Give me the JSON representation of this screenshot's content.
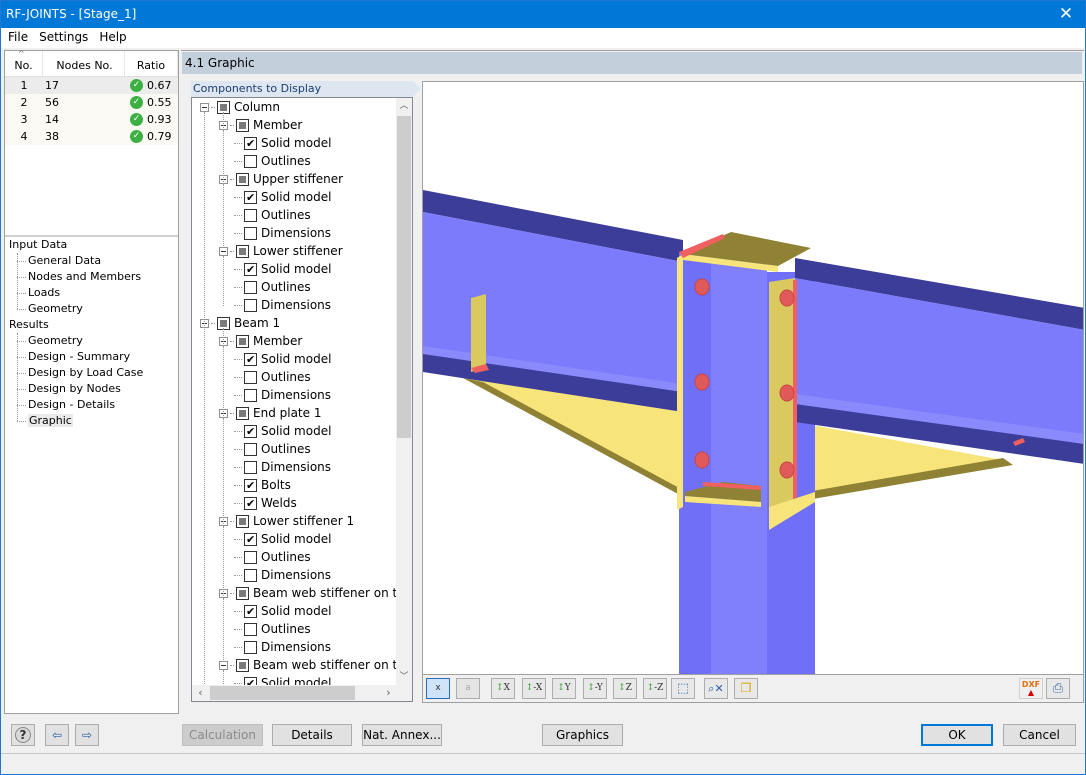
{
  "window": {
    "title": "RF-JOINTS - [Stage_1]",
    "close_icon": "close-icon"
  },
  "menu": [
    "File",
    "Settings",
    "Help"
  ],
  "nodes_table": {
    "columns": [
      "No.",
      "Nodes No.",
      "Ratio"
    ],
    "rows": [
      {
        "no": "1",
        "node": "17",
        "ratio": "0.67",
        "status": "ok"
      },
      {
        "no": "2",
        "node": "56",
        "ratio": "0.55",
        "status": "ok"
      },
      {
        "no": "3",
        "node": "14",
        "ratio": "0.93",
        "status": "ok"
      },
      {
        "no": "4",
        "node": "38",
        "ratio": "0.79",
        "status": "ok"
      }
    ]
  },
  "navigator": {
    "groups": [
      {
        "label": "Input Data",
        "items": [
          "General Data",
          "Nodes and Members",
          "Loads",
          "Geometry"
        ]
      },
      {
        "label": "Results",
        "items": [
          "Geometry",
          "Design - Summary",
          "Design by Load Case",
          "Design by Nodes",
          "Design - Details",
          "Graphic"
        ]
      }
    ],
    "selected": "Graphic"
  },
  "section": {
    "title": "4.1 Graphic"
  },
  "components": {
    "header": "Components to Display",
    "tree": [
      {
        "label": "Column",
        "level": 0,
        "state": "partial"
      },
      {
        "label": "Member",
        "level": 1,
        "state": "partial"
      },
      {
        "label": "Solid model",
        "level": 2,
        "state": "checked"
      },
      {
        "label": "Outlines",
        "level": 2,
        "state": "unchecked"
      },
      {
        "label": "Upper stiffener",
        "level": 1,
        "state": "partial"
      },
      {
        "label": "Solid model",
        "level": 2,
        "state": "checked"
      },
      {
        "label": "Outlines",
        "level": 2,
        "state": "unchecked"
      },
      {
        "label": "Dimensions",
        "level": 2,
        "state": "unchecked"
      },
      {
        "label": "Lower stiffener",
        "level": 1,
        "state": "partial"
      },
      {
        "label": "Solid model",
        "level": 2,
        "state": "checked"
      },
      {
        "label": "Outlines",
        "level": 2,
        "state": "unchecked"
      },
      {
        "label": "Dimensions",
        "level": 2,
        "state": "unchecked"
      },
      {
        "label": "Beam 1",
        "level": 0,
        "state": "partial"
      },
      {
        "label": "Member",
        "level": 1,
        "state": "partial"
      },
      {
        "label": "Solid model",
        "level": 2,
        "state": "checked"
      },
      {
        "label": "Outlines",
        "level": 2,
        "state": "unchecked"
      },
      {
        "label": "Dimensions",
        "level": 2,
        "state": "unchecked"
      },
      {
        "label": "End plate 1",
        "level": 1,
        "state": "partial"
      },
      {
        "label": "Solid model",
        "level": 2,
        "state": "checked"
      },
      {
        "label": "Outlines",
        "level": 2,
        "state": "unchecked"
      },
      {
        "label": "Dimensions",
        "level": 2,
        "state": "unchecked"
      },
      {
        "label": "Bolts",
        "level": 2,
        "state": "checked"
      },
      {
        "label": "Welds",
        "level": 2,
        "state": "checked"
      },
      {
        "label": "Lower stiffener 1",
        "level": 1,
        "state": "partial"
      },
      {
        "label": "Solid model",
        "level": 2,
        "state": "checked"
      },
      {
        "label": "Outlines",
        "level": 2,
        "state": "unchecked"
      },
      {
        "label": "Dimensions",
        "level": 2,
        "state": "unchecked"
      },
      {
        "label": "Beam web stiffener on tape",
        "level": 1,
        "state": "partial"
      },
      {
        "label": "Solid model",
        "level": 2,
        "state": "checked"
      },
      {
        "label": "Outlines",
        "level": 2,
        "state": "unchecked"
      },
      {
        "label": "Dimensions",
        "level": 2,
        "state": "unchecked"
      },
      {
        "label": "Beam web stiffener on tape",
        "level": 1,
        "state": "partial"
      },
      {
        "label": "Solid model",
        "level": 2,
        "state": "checked"
      }
    ]
  },
  "view_toolbar": {
    "buttons": [
      {
        "name": "show-dimensions-x",
        "label": "x",
        "state": "active"
      },
      {
        "name": "show-dimensions-a",
        "label": "a",
        "state": "disabled"
      },
      {
        "name": "view-x",
        "label": "X"
      },
      {
        "name": "view-minus-x",
        "label": "-X"
      },
      {
        "name": "view-y",
        "label": "Y"
      },
      {
        "name": "view-minus-y",
        "label": "-Y"
      },
      {
        "name": "view-z",
        "label": "Z"
      },
      {
        "name": "view-minus-z",
        "label": "-Z"
      },
      {
        "name": "isometric-view",
        "label": ""
      },
      {
        "name": "reset-zoom",
        "label": ""
      },
      {
        "name": "transparent-toggle",
        "label": ""
      }
    ],
    "right_buttons": [
      {
        "name": "dxf-export",
        "label": "DXF"
      },
      {
        "name": "print",
        "label": ""
      }
    ]
  },
  "colors": {
    "steel": "#7b7bfb",
    "steel_dark": "#3c3c99",
    "plate": "#f7e47a",
    "plate_dark": "#8f8234",
    "weld": "#f06060",
    "bolt": "#e05a5a"
  },
  "footer": {
    "calculation": "Calculation",
    "details": "Details",
    "nat_annex": "Nat. Annex...",
    "graphics": "Graphics",
    "ok": "OK",
    "cancel": "Cancel"
  }
}
